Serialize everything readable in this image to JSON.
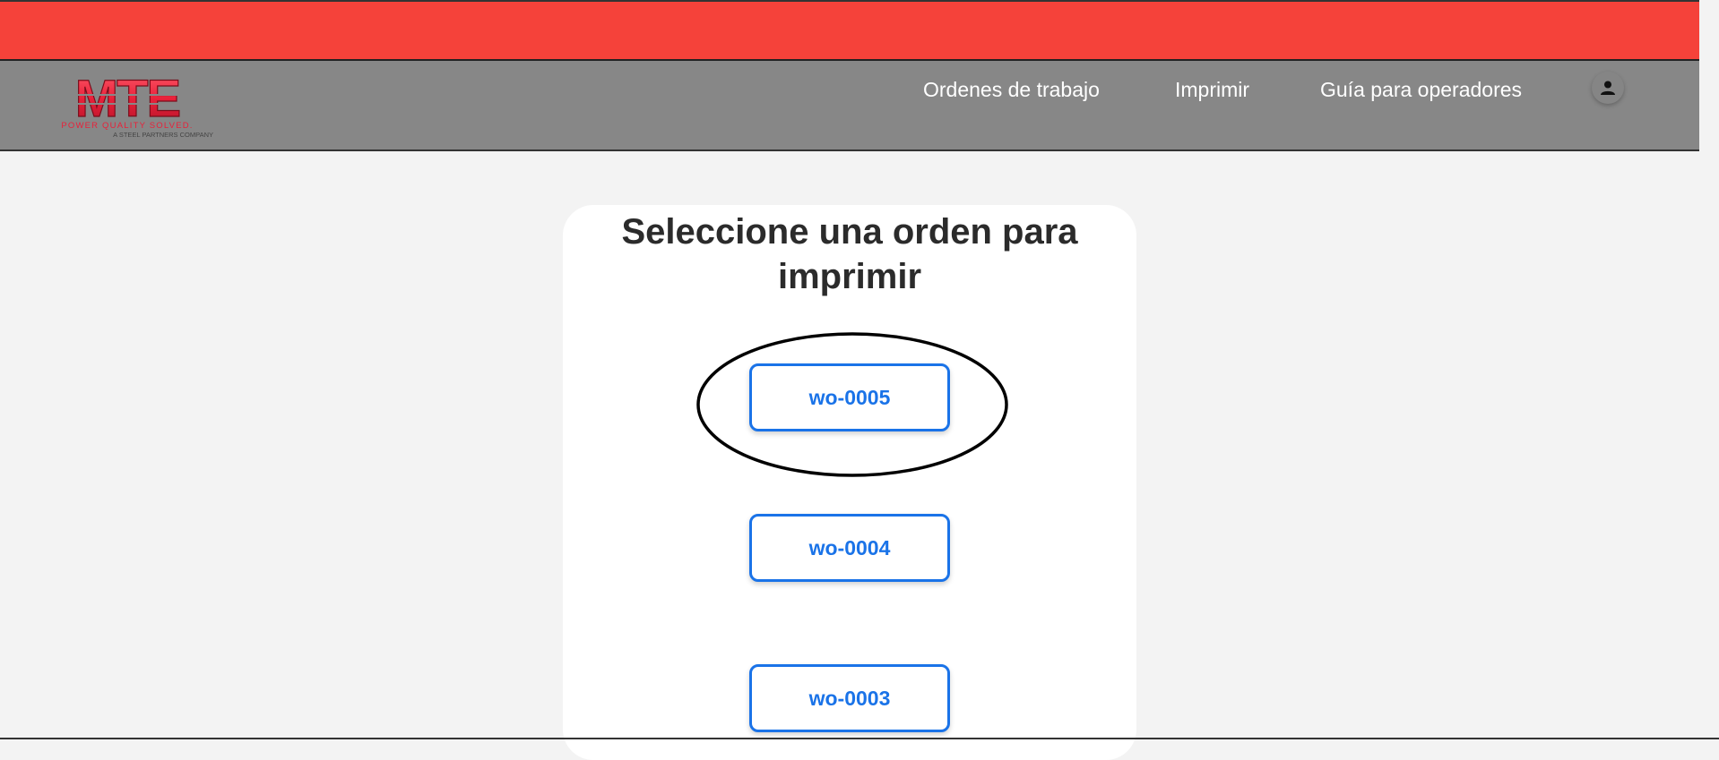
{
  "brand": {
    "logo_text": "MTE",
    "tagline": "POWER QUALITY SOLVED.",
    "subtagline": "A STEEL PARTNERS COMPANY",
    "color": "#e8213a"
  },
  "nav": {
    "items": [
      {
        "label": "Ordenes de trabajo"
      },
      {
        "label": "Imprimir"
      },
      {
        "label": "Guía para operadores"
      }
    ],
    "user_icon": "user-icon"
  },
  "main": {
    "title": "Seleccione una orden para imprimir",
    "orders": [
      {
        "label": "wo-0005"
      },
      {
        "label": "wo-0004"
      },
      {
        "label": "wo-0003"
      }
    ]
  },
  "colors": {
    "top_bar": "#f5423a",
    "navbar": "#878787",
    "accent": "#1a73e8",
    "background": "#f3f3f3"
  }
}
